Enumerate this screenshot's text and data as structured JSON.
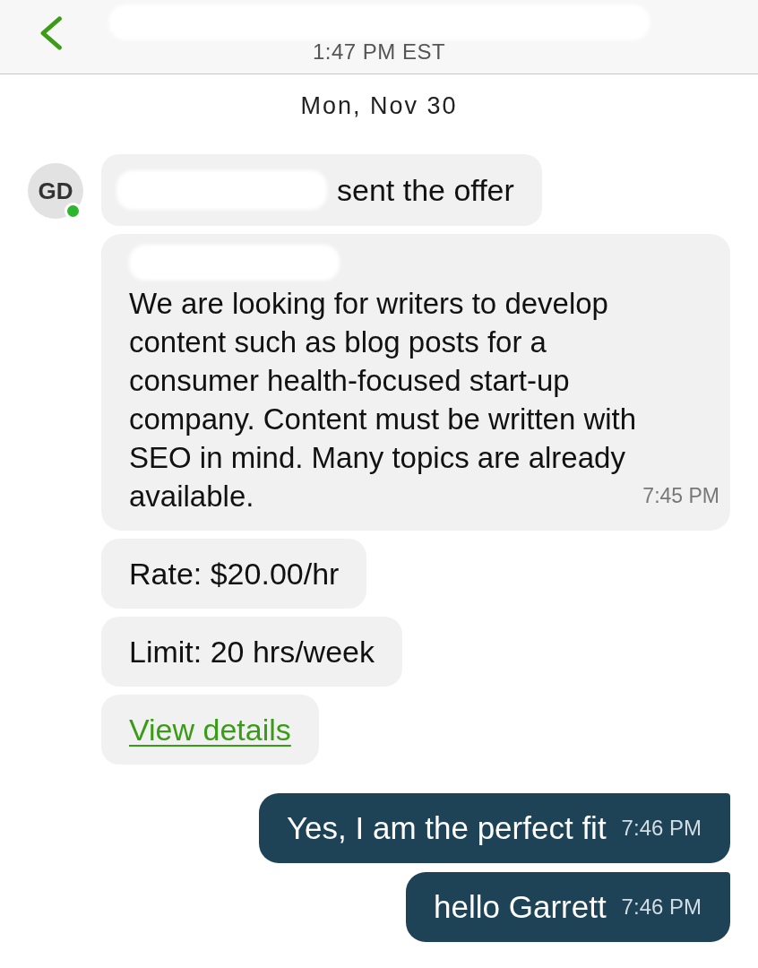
{
  "header": {
    "time": "1:47 PM EST"
  },
  "date_divider": "Mon, Nov 30",
  "incoming_group": {
    "avatar": {
      "initials": "GD",
      "online": true
    },
    "messages": [
      {
        "kind": "event",
        "text": "sent the offer"
      },
      {
        "kind": "note",
        "text": "We are looking for writers to develop content such as blog posts for a consumer health-focused start-up company. Content must be written with SEO in mind. Many topics are already available.",
        "time": "7:45 PM"
      },
      {
        "kind": "term",
        "text": "Rate: $20.00/hr"
      },
      {
        "kind": "term",
        "text": "Limit: 20 hrs/week"
      },
      {
        "kind": "link",
        "text": "View details"
      }
    ]
  },
  "outgoing_messages": [
    {
      "text": "Yes, I am the perfect fit",
      "time": "7:46 PM"
    },
    {
      "text": "hello Garrett",
      "time": "7:46 PM"
    }
  ]
}
